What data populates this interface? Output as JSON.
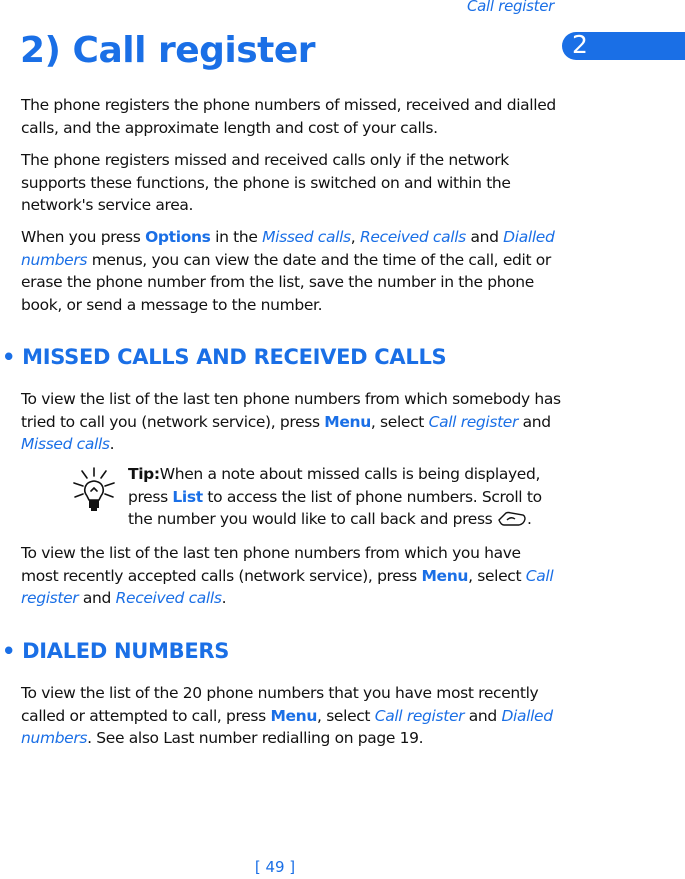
{
  "running_head": "Call register",
  "chapter_tab": "2",
  "title": "2) Call register",
  "intro": [
    "The phone registers the phone numbers of missed, received and dialled calls, and the approximate length and cost of your calls.",
    "The phone registers missed and received calls only if the network supports these functions, the phone is switched on and within the network's service area."
  ],
  "options_para": {
    "t1": "When you press ",
    "options": "Options",
    "t2": " in the ",
    "missed": "Missed calls",
    "t3": ", ",
    "received": "Received calls",
    "t4": " and ",
    "dialled": "Dialled numbers",
    "t5": " menus, you can view the date and the time of the call, edit or erase the phone number from the list, save the number in the phone book, or send a message to the number."
  },
  "section_missed": {
    "heading": "• MISSED CALLS AND RECEIVED CALLS",
    "para1": {
      "t1": "To view the list of the last ten phone numbers from which somebody has tried to call you (network service), press ",
      "menu": "Menu",
      "t2": ", select ",
      "call_register": "Call register",
      "t3": " and ",
      "missed": "Missed calls",
      "t4": "."
    },
    "tip": {
      "label": "Tip:",
      "t1": "When a note about missed calls is being displayed, press ",
      "list": "List",
      "t2": " to access the list of phone numbers. Scroll to the number you would like to call back and press ",
      "t3": ".",
      "icon": "call-key-icon"
    },
    "para2": {
      "t1": "To view the list of the last ten phone numbers from which you have most recently accepted calls (network service), press ",
      "menu": "Menu",
      "t2": ", select ",
      "call_register": "Call register",
      "t3": " and ",
      "received": "Received calls",
      "t4": "."
    }
  },
  "section_dialed": {
    "heading": "• DIALED NUMBERS",
    "para": {
      "t1": "To view the list of the 20 phone numbers that you have most recently called or attempted to call, press ",
      "menu": "Menu",
      "t2": ", select ",
      "call_register": "Call register",
      "t3": " and ",
      "dialled": "Dialled numbers",
      "t4": ". See also Last number redialling on page 19."
    }
  },
  "page_number": "[ 49 ]",
  "colors": {
    "accent": "#1a6fe6",
    "text": "#111111"
  }
}
